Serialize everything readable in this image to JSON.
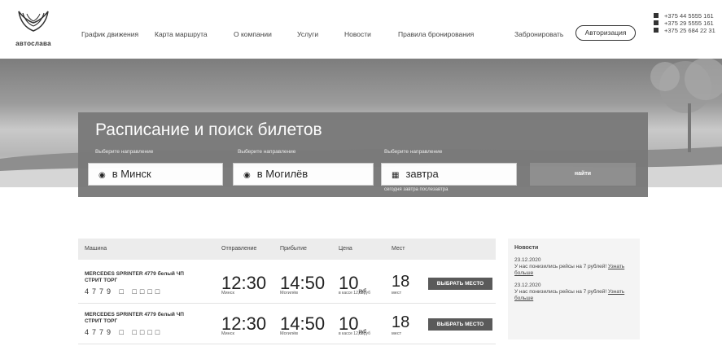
{
  "header": {
    "logo_text": "автослава",
    "nav": [
      "График движения",
      "Карта маршрута",
      "О компании",
      "Услуги",
      "Новости",
      "Правила бронирования"
    ],
    "book_label": "Забронировать",
    "auth_label": "Авторизация",
    "phones": [
      "+375 44 5555 161",
      "+375 29 5555 161",
      "+375 25 684 22 31"
    ]
  },
  "search": {
    "title": "Расписание и поиск билетов",
    "from_label": "Выберите направление",
    "to_label": "Выберите направление",
    "date_label": "Выберите направление",
    "from_value": "в Минск",
    "to_value": "в Могилёв",
    "date_value": "завтра",
    "date_hint": "сегодня завтра послезавтра",
    "find_label": "найти"
  },
  "table": {
    "headers": {
      "car": "Машина",
      "departure": "Отправление",
      "arrival": "Прибытие",
      "price": "Цена",
      "seats": "Мест"
    },
    "rows": [
      {
        "model": "MERCEDES SPRINTER 4779 белый ЧП СТРИТ ТОРГ",
        "plate": "4779 □ □□□□",
        "dep_time": "12:30",
        "dep_city": "Минск",
        "arr_time": "14:50",
        "arr_city": "Могилёв",
        "price": "10",
        "price_cents": "руб",
        "price_note": "в кассе 12,00руб",
        "seats": "18",
        "seats_label": "мест",
        "button": "ВЫБРАТЬ МЕСТО"
      },
      {
        "model": "MERCEDES SPRINTER 4779 белый ЧП СТРИТ ТОРГ",
        "plate": "4779 □ □□□□",
        "dep_time": "12:30",
        "dep_city": "Минск",
        "arr_time": "14:50",
        "arr_city": "Могилёв",
        "price": "10",
        "price_cents": "руб",
        "price_note": "в кассе 12,00руб",
        "seats": "18",
        "seats_label": "мест",
        "button": "ВЫБРАТЬ МЕСТО"
      }
    ]
  },
  "news": {
    "title": "Новости",
    "items": [
      {
        "date": "23.12.2020",
        "text": "У нас понизились рейсы на 7 рублей!",
        "link": "Узнать больше"
      },
      {
        "date": "23.12.2020",
        "text": "У нас понизились рейсы на 7 рублей!",
        "link": "Узнать больше"
      }
    ]
  }
}
